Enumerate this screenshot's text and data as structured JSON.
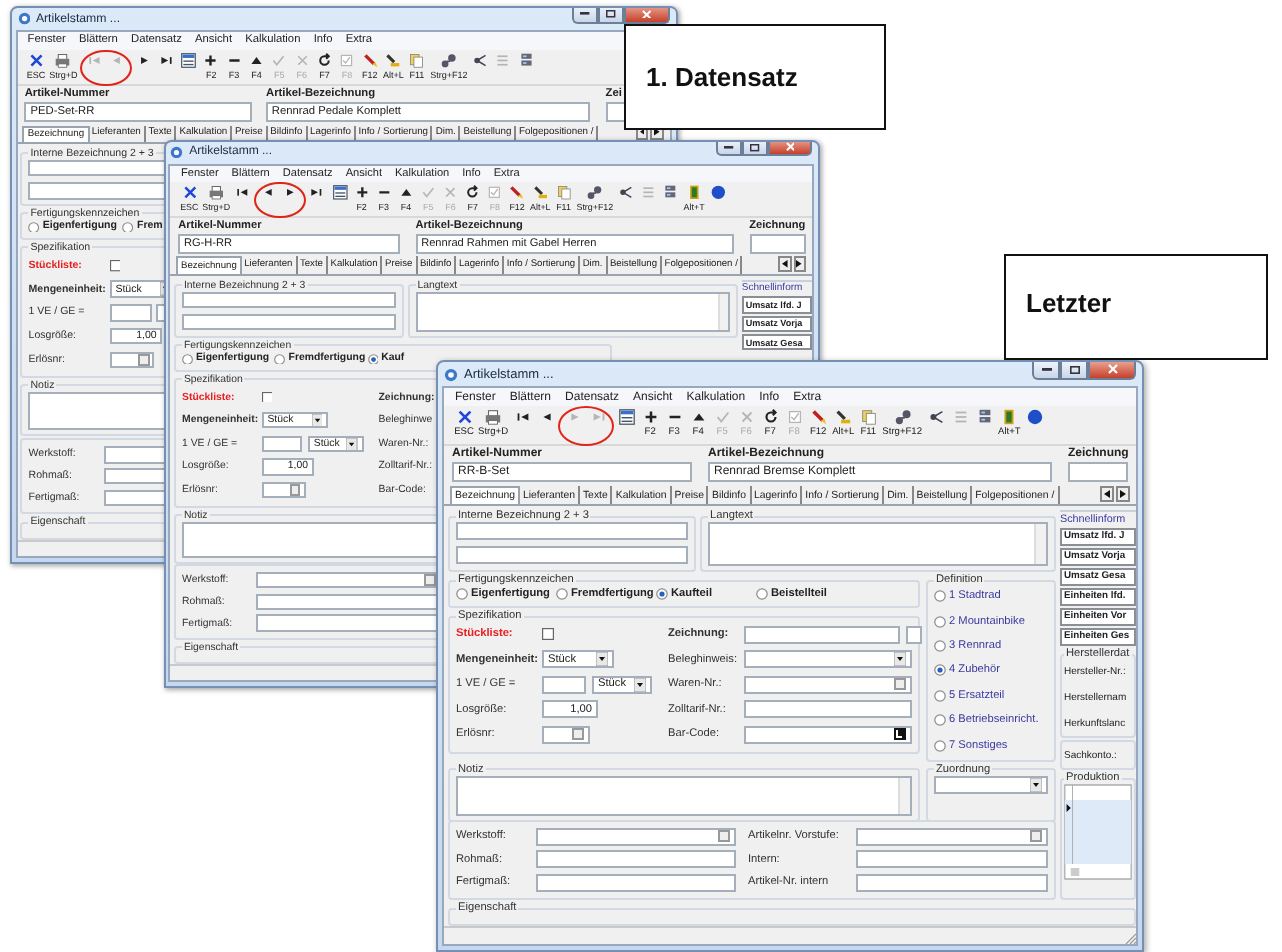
{
  "windows": [
    {
      "title": "Artikelstamm ...",
      "menu": [
        "Fenster",
        "Blättern",
        "Datensatz",
        "Ansicht",
        "Kalkulation",
        "Info",
        "Extra"
      ],
      "toolbar": [
        {
          "kind": "esc",
          "label": "ESC",
          "disabled": false,
          "circled": false
        },
        {
          "kind": "print",
          "label": "Strg+D",
          "disabled": false,
          "circled": false
        },
        {
          "kind": "first",
          "disabled": true,
          "circled": true
        },
        {
          "kind": "prev",
          "disabled": true,
          "circled": true
        },
        {
          "kind": "next",
          "disabled": false,
          "circled": false
        },
        {
          "kind": "last",
          "disabled": false,
          "circled": false
        },
        {
          "kind": "form",
          "disabled": false,
          "circled": false
        },
        {
          "kind": "plus",
          "label": "F2",
          "disabled": false,
          "circled": false
        },
        {
          "kind": "minus",
          "label": "F3",
          "disabled": false,
          "circled": false
        },
        {
          "kind": "up",
          "label": "F4",
          "disabled": false,
          "circled": false
        },
        {
          "kind": "check",
          "label": "F5",
          "disabled": true,
          "circled": false
        },
        {
          "kind": "cross",
          "label": "F6",
          "disabled": true,
          "circled": false
        },
        {
          "kind": "refresh",
          "label": "F7",
          "disabled": false,
          "circled": false
        },
        {
          "kind": "checkbox",
          "label": "F8",
          "disabled": true,
          "circled": false
        },
        {
          "kind": "pen",
          "label": "F12",
          "disabled": false,
          "circled": false
        },
        {
          "kind": "marker",
          "label": "Alt+L",
          "disabled": false,
          "circled": false
        },
        {
          "kind": "copy",
          "label": "F11",
          "disabled": false,
          "circled": false
        },
        {
          "kind": "tree",
          "label": "Strg+F12",
          "disabled": false,
          "circled": false
        },
        {
          "kind": "share",
          "disabled": false,
          "circled": false
        },
        {
          "kind": "list",
          "disabled": true,
          "circled": false
        },
        {
          "kind": "server",
          "disabled": false,
          "circled": false
        }
      ],
      "header": {
        "number_label": "Artikel-Nummer",
        "number": "PED-Set-RR",
        "name_label": "Artikel-Bezeichnung",
        "name": "Rennrad Pedale Komplett",
        "drawing_label": "Zei"
      },
      "tabs": [
        {
          "label": "Bezeichnung",
          "selected": true
        },
        {
          "label": "Lieferanten",
          "selected": false
        },
        {
          "label": "Texte",
          "selected": false
        },
        {
          "label": "Kalkulation",
          "selected": false
        },
        {
          "label": "Preise",
          "selected": false
        },
        {
          "label": "Bildinfo",
          "selected": false
        },
        {
          "label": "Lagerinfo",
          "selected": false
        },
        {
          "label": "Info / Sortierung",
          "selected": false
        },
        {
          "label": "Dim.",
          "selected": false
        },
        {
          "label": "Beistellung",
          "selected": false
        },
        {
          "label": "Folgepositionen /",
          "selected": false
        }
      ],
      "internal": {
        "label": "Interne Bezeichnung 2 + 3"
      },
      "production": {
        "label": "Fertigungskennzeichen",
        "options": [
          {
            "label": "Eigenfertigung",
            "selected": false
          },
          {
            "label": "Frem",
            "selected": false
          }
        ]
      },
      "specification": {
        "label": "Spezifikation",
        "left": [
          {
            "kind": "check",
            "label": "Stückliste:",
            "checked": false,
            "strong": true
          },
          {
            "kind": "select",
            "label": "Mengeneinheit:",
            "value": "Stück",
            "strong": true
          },
          {
            "kind": "ve",
            "label": "1 VE / GE =",
            "strong": false
          },
          {
            "kind": "text",
            "label": "Losgröße:",
            "value": "1,00",
            "strong": false
          },
          {
            "kind": "lookup",
            "label": "Erlösnr:",
            "strong": false
          }
        ]
      },
      "note": {
        "label": "Notiz"
      },
      "material": {
        "left": [
          {
            "kind": "lookup",
            "label": "Werkstoff:"
          },
          {
            "kind": "text",
            "label": "Rohmaß:"
          },
          {
            "kind": "text",
            "label": "Fertigmaß:"
          }
        ]
      },
      "property": {
        "label": "Eigenschaft"
      }
    },
    {
      "title": "Artikelstamm ...",
      "menu": [
        "Fenster",
        "Blättern",
        "Datensatz",
        "Ansicht",
        "Kalkulation",
        "Info",
        "Extra"
      ],
      "toolbar": [
        {
          "kind": "esc",
          "label": "ESC",
          "disabled": false,
          "circled": false
        },
        {
          "kind": "print",
          "label": "Strg+D",
          "disabled": false,
          "circled": false
        },
        {
          "kind": "first",
          "disabled": false,
          "circled": false
        },
        {
          "kind": "prev",
          "disabled": false,
          "circled": true
        },
        {
          "kind": "next",
          "disabled": false,
          "circled": true
        },
        {
          "kind": "last",
          "disabled": false,
          "circled": false
        },
        {
          "kind": "form",
          "disabled": false,
          "circled": false
        },
        {
          "kind": "plus",
          "label": "F2",
          "disabled": false,
          "circled": false
        },
        {
          "kind": "minus",
          "label": "F3",
          "disabled": false,
          "circled": false
        },
        {
          "kind": "up",
          "label": "F4",
          "disabled": false,
          "circled": false
        },
        {
          "kind": "check",
          "label": "F5",
          "disabled": true,
          "circled": false
        },
        {
          "kind": "cross",
          "label": "F6",
          "disabled": true,
          "circled": false
        },
        {
          "kind": "refresh",
          "label": "F7",
          "disabled": false,
          "circled": false
        },
        {
          "kind": "checkbox",
          "label": "F8",
          "disabled": true,
          "circled": false
        },
        {
          "kind": "pen",
          "label": "F12",
          "disabled": false,
          "circled": false
        },
        {
          "kind": "marker",
          "label": "Alt+L",
          "disabled": false,
          "circled": false
        },
        {
          "kind": "copy",
          "label": "F11",
          "disabled": false,
          "circled": false
        },
        {
          "kind": "tree",
          "label": "Strg+F12",
          "disabled": false,
          "circled": false
        },
        {
          "kind": "share",
          "disabled": false,
          "circled": false
        },
        {
          "kind": "list",
          "disabled": true,
          "circled": false
        },
        {
          "kind": "server",
          "disabled": false,
          "circled": false
        },
        {
          "kind": "door",
          "label": "Alt+T",
          "disabled": false,
          "circled": false
        },
        {
          "kind": "globe",
          "disabled": false,
          "circled": false
        }
      ],
      "header": {
        "number_label": "Artikel-Nummer",
        "number": "RG-H-RR",
        "name_label": "Artikel-Bezeichnung",
        "name": "Rennrad Rahmen mit Gabel Herren",
        "drawing_label": "Zeichnung"
      },
      "tabs": [
        {
          "label": "Bezeichnung",
          "selected": true
        },
        {
          "label": "Lieferanten",
          "selected": false
        },
        {
          "label": "Texte",
          "selected": false
        },
        {
          "label": "Kalkulation",
          "selected": false
        },
        {
          "label": "Preise",
          "selected": false
        },
        {
          "label": "Bildinfo",
          "selected": false
        },
        {
          "label": "Lagerinfo",
          "selected": false
        },
        {
          "label": "Info / Sortierung",
          "selected": false
        },
        {
          "label": "Dim.",
          "selected": false
        },
        {
          "label": "Beistellung",
          "selected": false
        },
        {
          "label": "Folgepositionen /",
          "selected": false
        }
      ],
      "internal": {
        "label": "Interne Bezeichnung 2 + 3"
      },
      "longtext": {
        "label": "Langtext"
      },
      "production": {
        "label": "Fertigungskennzeichen",
        "options": [
          {
            "label": "Eigenfertigung",
            "selected": false
          },
          {
            "label": "Fremdfertigung",
            "selected": false
          },
          {
            "label": "Kauf",
            "selected": true
          }
        ]
      },
      "specification": {
        "label": "Spezifikation",
        "left": [
          {
            "kind": "check",
            "label": "Stückliste:",
            "checked": false,
            "strong": true
          },
          {
            "kind": "select",
            "label": "Mengeneinheit:",
            "value": "Stück",
            "strong": true
          },
          {
            "kind": "ve",
            "label": "1 VE / GE =",
            "unit": "Stück",
            "strong": false
          },
          {
            "kind": "text",
            "label": "Losgröße:",
            "value": "1,00",
            "strong": false
          },
          {
            "kind": "lookup",
            "label": "Erlösnr:",
            "strong": false
          }
        ],
        "right": [
          {
            "kind": "label",
            "label": "Zeichnung:",
            "strong": true
          },
          {
            "kind": "label",
            "label": "Beleghinwe",
            "strong": false
          },
          {
            "kind": "label",
            "label": "Waren-Nr.:",
            "strong": false
          },
          {
            "kind": "label",
            "label": "Zolltarif-Nr.:",
            "strong": false
          },
          {
            "kind": "label",
            "label": "Bar-Code:",
            "strong": false
          }
        ]
      },
      "note": {
        "label": "Notiz"
      },
      "material": {
        "left": [
          {
            "kind": "lookup",
            "label": "Werkstoff:"
          },
          {
            "kind": "text",
            "label": "Rohmaß:"
          },
          {
            "kind": "text",
            "label": "Fertigmaß:"
          }
        ]
      },
      "property": {
        "label": "Eigenschaft"
      },
      "sidebar": {
        "title": "Schnellinform",
        "buttons": [
          "Umsatz lfd. J",
          "Umsatz Vorja",
          "Umsatz Gesa"
        ]
      }
    },
    {
      "title": "Artikelstamm ...",
      "menu": [
        "Fenster",
        "Blättern",
        "Datensatz",
        "Ansicht",
        "Kalkulation",
        "Info",
        "Extra"
      ],
      "toolbar": [
        {
          "kind": "esc",
          "label": "ESC",
          "disabled": false,
          "circled": false
        },
        {
          "kind": "print",
          "label": "Strg+D",
          "disabled": false,
          "circled": false
        },
        {
          "kind": "first",
          "disabled": false,
          "circled": false
        },
        {
          "kind": "prev",
          "disabled": false,
          "circled": false
        },
        {
          "kind": "next",
          "disabled": true,
          "circled": true
        },
        {
          "kind": "last",
          "disabled": true,
          "circled": true
        },
        {
          "kind": "form",
          "disabled": false,
          "circled": false
        },
        {
          "kind": "plus",
          "label": "F2",
          "disabled": false,
          "circled": false
        },
        {
          "kind": "minus",
          "label": "F3",
          "disabled": false,
          "circled": false
        },
        {
          "kind": "up",
          "label": "F4",
          "disabled": false,
          "circled": false
        },
        {
          "kind": "check",
          "label": "F5",
          "disabled": true,
          "circled": false
        },
        {
          "kind": "cross",
          "label": "F6",
          "disabled": true,
          "circled": false
        },
        {
          "kind": "refresh",
          "label": "F7",
          "disabled": false,
          "circled": false
        },
        {
          "kind": "checkbox",
          "label": "F8",
          "disabled": true,
          "circled": false
        },
        {
          "kind": "pen",
          "label": "F12",
          "disabled": false,
          "circled": false
        },
        {
          "kind": "marker",
          "label": "Alt+L",
          "disabled": false,
          "circled": false
        },
        {
          "kind": "copy",
          "label": "F11",
          "disabled": false,
          "circled": false
        },
        {
          "kind": "tree",
          "label": "Strg+F12",
          "disabled": false,
          "circled": false
        },
        {
          "kind": "share",
          "disabled": false,
          "circled": false
        },
        {
          "kind": "list",
          "disabled": true,
          "circled": false
        },
        {
          "kind": "server",
          "disabled": false,
          "circled": false
        },
        {
          "kind": "door",
          "label": "Alt+T",
          "disabled": false,
          "circled": false
        },
        {
          "kind": "globe",
          "disabled": false,
          "circled": false
        }
      ],
      "header": {
        "number_label": "Artikel-Nummer",
        "number": "RR-B-Set",
        "name_label": "Artikel-Bezeichnung",
        "name": "Rennrad Bremse Komplett",
        "drawing_label": "Zeichnung"
      },
      "tabs": [
        {
          "label": "Bezeichnung",
          "selected": true
        },
        {
          "label": "Lieferanten",
          "selected": false
        },
        {
          "label": "Texte",
          "selected": false
        },
        {
          "label": "Kalkulation",
          "selected": false
        },
        {
          "label": "Preise",
          "selected": false
        },
        {
          "label": "Bildinfo",
          "selected": false
        },
        {
          "label": "Lagerinfo",
          "selected": false
        },
        {
          "label": "Info / Sortierung",
          "selected": false
        },
        {
          "label": "Dim.",
          "selected": false
        },
        {
          "label": "Beistellung",
          "selected": false
        },
        {
          "label": "Folgepositionen /",
          "selected": false
        }
      ],
      "internal": {
        "label": "Interne Bezeichnung 2 + 3"
      },
      "longtext": {
        "label": "Langtext"
      },
      "production": {
        "label": "Fertigungskennzeichen",
        "options": [
          {
            "label": "Eigenfertigung",
            "selected": false
          },
          {
            "label": "Fremdfertigung",
            "selected": false
          },
          {
            "label": "Kaufteil",
            "selected": true
          },
          {
            "label": "Beistellteil",
            "selected": false
          }
        ]
      },
      "specification": {
        "label": "Spezifikation",
        "left": [
          {
            "kind": "check",
            "label": "Stückliste:",
            "checked": false,
            "strong": true
          },
          {
            "kind": "select",
            "label": "Mengeneinheit:",
            "value": "Stück",
            "strong": true
          },
          {
            "kind": "ve",
            "label": "1 VE / GE =",
            "unit": "Stück",
            "strong": false
          },
          {
            "kind": "text",
            "label": "Losgröße:",
            "value": "1,00",
            "strong": false
          },
          {
            "kind": "lookup",
            "label": "Erlösnr:",
            "strong": false
          }
        ],
        "right": [
          {
            "kind": "drawing",
            "label": "Zeichnung:",
            "strong": true
          },
          {
            "kind": "select",
            "label": "Beleghinweis:",
            "strong": false
          },
          {
            "kind": "lookup",
            "label": "Waren-Nr.:",
            "strong": false
          },
          {
            "kind": "text",
            "label": "Zolltarif-Nr.:",
            "strong": false
          },
          {
            "kind": "barcode",
            "label": "Bar-Code:",
            "strong": false
          }
        ]
      },
      "definition": {
        "label": "Definition",
        "options": [
          {
            "label": "1 Stadtrad",
            "selected": false
          },
          {
            "label": "2 Mountainbike",
            "selected": false
          },
          {
            "label": "3 Rennrad",
            "selected": false
          },
          {
            "label": "4 Zubehör",
            "selected": true
          },
          {
            "label": "5 Ersatzteil",
            "selected": false
          },
          {
            "label": "6 Betriebseinricht.",
            "selected": false
          },
          {
            "label": "7 Sonstiges",
            "selected": false
          }
        ]
      },
      "note": {
        "label": "Notiz"
      },
      "assignment": {
        "label": "Zuordnung"
      },
      "material": {
        "left": [
          {
            "kind": "lookup",
            "label": "Werkstoff:"
          },
          {
            "kind": "text",
            "label": "Rohmaß:"
          },
          {
            "kind": "text",
            "label": "Fertigmaß:"
          }
        ],
        "right": [
          {
            "kind": "lookup",
            "label": "Artikelnr. Vorstufe:"
          },
          {
            "kind": "text",
            "label": "Intern:"
          },
          {
            "kind": "text",
            "label": "Artikel-Nr. intern"
          }
        ]
      },
      "property": {
        "label": "Eigenschaft"
      },
      "sidebar": {
        "title": "Schnellinform",
        "buttons": [
          "Umsatz lfd. J",
          "Umsatz Vorja",
          "Umsatz Gesa",
          "Einheiten lfd.",
          "Einheiten Vor",
          "Einheiten Ges"
        ],
        "manufacturer": {
          "label": "Herstellerdat",
          "rows": [
            "Hersteller-Nr.:",
            "Herstellernam",
            "Herkunftslanc"
          ]
        },
        "account": "Sachkonto.:",
        "production": {
          "label": "Produktion"
        }
      }
    }
  ],
  "callouts": [
    "1. Datensatz",
    "Letzter"
  ]
}
